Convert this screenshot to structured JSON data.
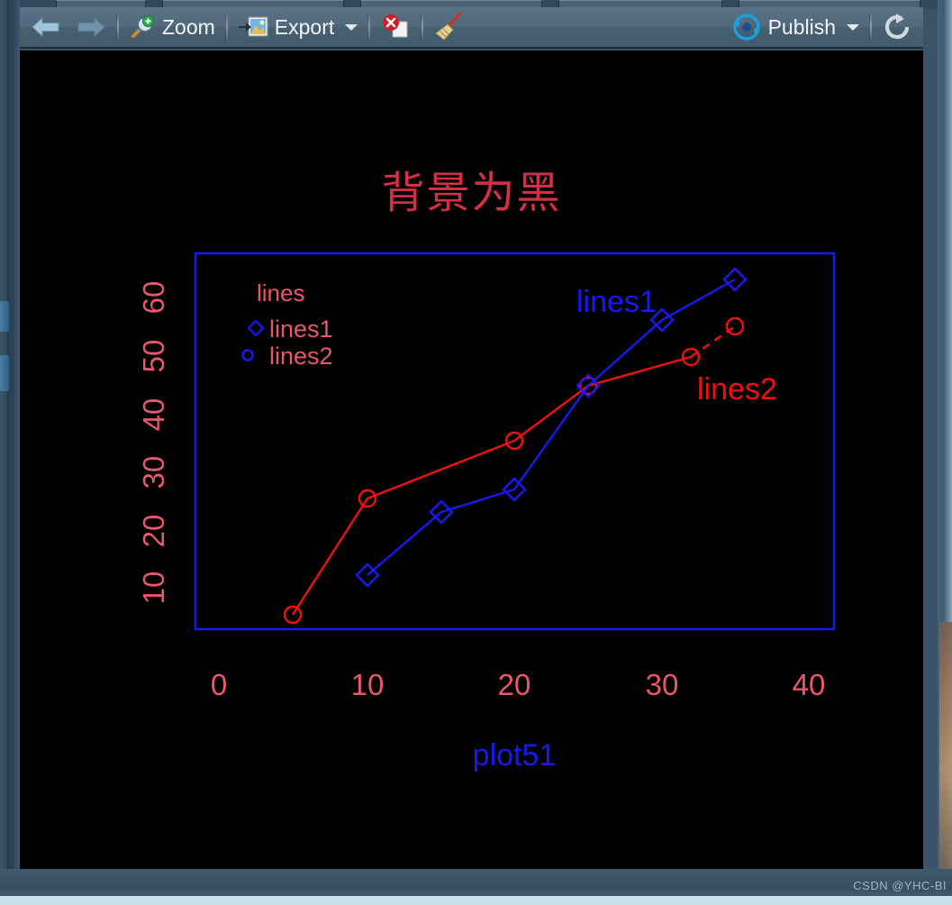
{
  "window": {
    "watermark": "CSDN @YHC-BI"
  },
  "toolbar": {
    "back_icon": "back-arrow-icon",
    "forward_icon": "forward-arrow-icon",
    "zoom_label": "Zoom",
    "zoom_icon": "magnifier-plus-icon",
    "export_label": "Export",
    "export_icon": "image-export-icon",
    "export_caret": "chevron-down-icon",
    "delete_icon": "delete-page-icon",
    "clear_icon": "broom-icon",
    "publish_label": "Publish",
    "publish_icon": "publish-icon",
    "publish_caret": "chevron-down-icon",
    "refresh_icon": "refresh-icon"
  },
  "chart_data": {
    "type": "line",
    "title": "背景为黑",
    "xlabel": "plot51",
    "ylabel": "",
    "background": "#000000",
    "frame_color": "#1818f0",
    "tick_color": "#e8576b",
    "grid": false,
    "xlim": [
      0,
      40
    ],
    "ylim": [
      0,
      65
    ],
    "xticks": [
      0,
      10,
      20,
      30,
      40
    ],
    "xticklabels": [
      "0",
      "10",
      "20",
      "30",
      "40"
    ],
    "yticks": [
      10,
      20,
      30,
      40,
      50,
      60
    ],
    "yticklabels": [
      "10",
      "20",
      "30",
      "40",
      "50",
      "60"
    ],
    "ytick_rotation": 90,
    "legend": {
      "title": "lines",
      "position": "inside-top-left",
      "entries": [
        {
          "label": "lines1",
          "marker": "diamond",
          "color": "#1818f0"
        },
        {
          "label": "lines2",
          "marker": "circle",
          "color": "#1818f0"
        }
      ]
    },
    "annotations": [
      {
        "text": "lines1",
        "color": "#1818f0",
        "x": 24.0,
        "y": 58.0
      },
      {
        "text": "lines2",
        "color": "#f01010",
        "x": 33.5,
        "y": 43.0
      }
    ],
    "series": [
      {
        "name": "lines1",
        "color": "#1818f0",
        "marker": "diamond",
        "linestyle": "solid",
        "x": [
          10,
          15,
          20,
          25,
          30,
          35
        ],
        "y": [
          12,
          23,
          27,
          45,
          56,
          63
        ]
      },
      {
        "name": "lines2",
        "color": "#f01010",
        "marker": "circle",
        "linestyle": "solid",
        "dashed_segment_from_index": 4,
        "x": [
          5,
          10,
          20,
          25,
          32,
          35
        ],
        "y": [
          5,
          25,
          35,
          45,
          50,
          55
        ]
      }
    ]
  }
}
